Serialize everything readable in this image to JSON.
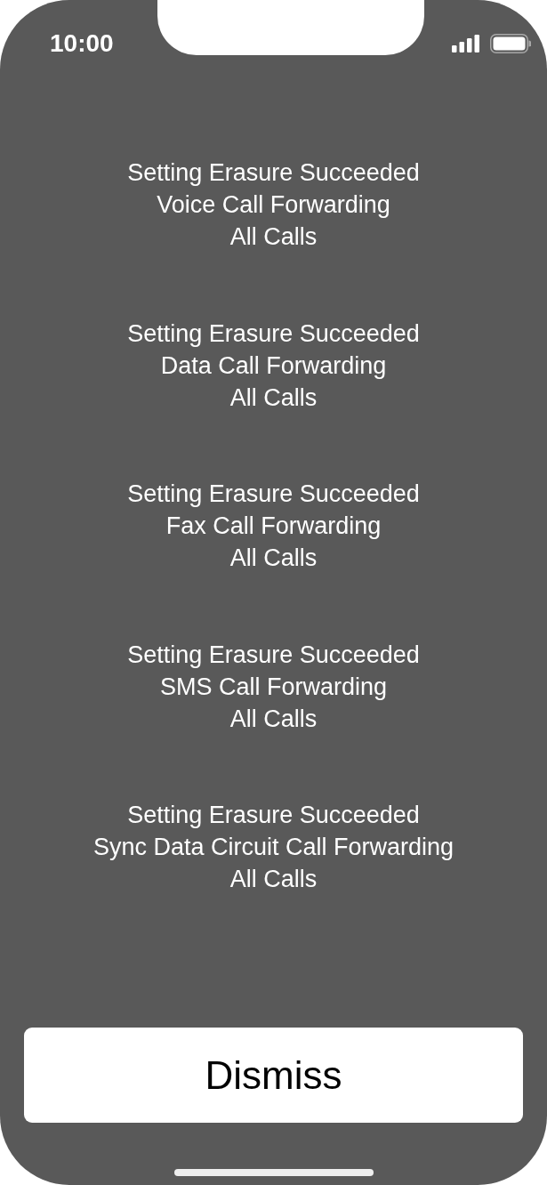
{
  "status_bar": {
    "time": "10:00"
  },
  "messages": [
    {
      "status": "Setting Erasure Succeeded",
      "service": "Voice Call Forwarding",
      "condition": "All Calls"
    },
    {
      "status": "Setting Erasure Succeeded",
      "service": "Data Call Forwarding",
      "condition": "All Calls"
    },
    {
      "status": "Setting Erasure Succeeded",
      "service": "Fax Call Forwarding",
      "condition": "All Calls"
    },
    {
      "status": "Setting Erasure Succeeded",
      "service": "SMS Call Forwarding",
      "condition": "All Calls"
    },
    {
      "status": "Setting Erasure Succeeded",
      "service": "Sync Data Circuit Call Forwarding",
      "condition": "All Calls"
    }
  ],
  "dismiss_button": {
    "label": "Dismiss"
  }
}
